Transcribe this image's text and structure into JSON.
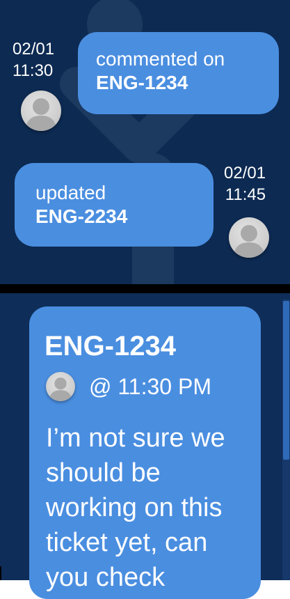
{
  "activity": [
    {
      "date": "02/01",
      "time": "11:30",
      "action": "commented on",
      "ticket": "ENG-1234",
      "avatar_icon": "user-avatar-icon"
    },
    {
      "date": "02/01",
      "time": "11:45",
      "action": "updated",
      "ticket": "ENG-2234",
      "avatar_icon": "user-avatar-icon"
    }
  ],
  "detail": {
    "ticket": "ENG-1234",
    "time": "@ 11:30 PM",
    "body": "I’m not sure we should be working on this ticket yet, can you check"
  },
  "colors": {
    "background": "#0d2a52",
    "bubble": "#4a8ee0",
    "text": "#ffffff"
  }
}
